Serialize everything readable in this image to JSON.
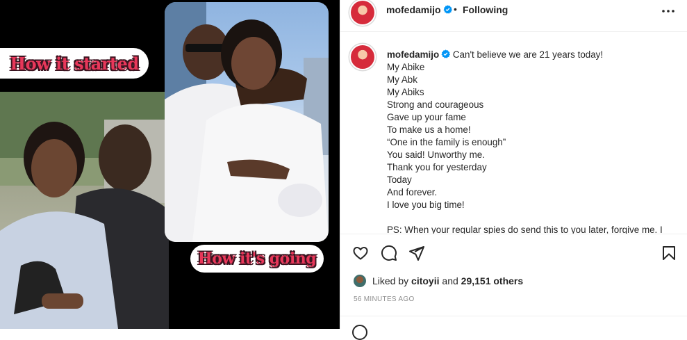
{
  "post": {
    "username": "mofedamijo",
    "follow_status": "Following",
    "separator": "•",
    "more_label": "More options"
  },
  "media": {
    "caption_top": "How it started",
    "caption_bottom": "How it's going"
  },
  "caption": {
    "username": "mofedamijo",
    "first_line": "Can't believe we are 21 years today!",
    "lines": [
      "My Abike",
      "My Abk",
      "My Abiks",
      "Strong and courageous",
      "Gave up your fame",
      "To make us a home!",
      "“One in the family is enough”",
      "You said! Unworthy me.",
      "Thank you for yesterday",
      "Today",
      "And forever.",
      "I love you big time!",
      "",
      "PS: When your regular spies do send this to you later, forgive me. I"
    ]
  },
  "engagement": {
    "liked_by_prefix": "Liked by",
    "liked_by_user": "citoyii",
    "and_text": "and",
    "others_count": "29,151 others",
    "timestamp": "56 MINUTES AGO"
  },
  "colors": {
    "caption_text": "#e8375a",
    "verified_badge": "#0095f6",
    "text_primary": "#262626",
    "text_secondary": "#8e8e8e",
    "divider": "#efefef"
  },
  "icons": {
    "like": "heart-icon",
    "comment": "comment-bubble-icon",
    "share": "paper-plane-icon",
    "save": "bookmark-icon",
    "more": "ellipsis-icon",
    "verified": "verified-badge-icon",
    "emoji": "emoji-icon"
  }
}
